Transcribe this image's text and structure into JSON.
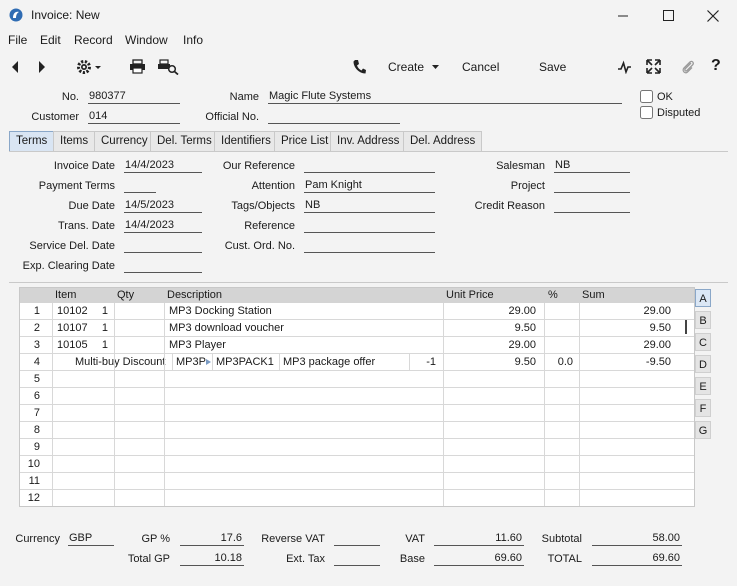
{
  "window": {
    "title": "Invoice: New",
    "minimize_glyph": "—",
    "maximize_glyph": "☐",
    "close_glyph": "✕"
  },
  "menu": [
    "File",
    "Edit",
    "Record",
    "Window",
    "Info"
  ],
  "toolbar": {
    "create_label": "Create",
    "cancel_label": "Cancel",
    "save_label": "Save",
    "help_label": "?"
  },
  "header": {
    "no_label": "No.",
    "no_value": "980377",
    "name_label": "Name",
    "name_value": "Magic Flute Systems",
    "customer_label": "Customer",
    "customer_value": "014",
    "official_label": "Official No.",
    "official_value": "",
    "ok_label": "OK",
    "disputed_label": "Disputed"
  },
  "tabs": [
    "Terms",
    "Items",
    "Currency",
    "Del. Terms",
    "Identifiers",
    "Price List",
    "Inv. Address",
    "Del. Address"
  ],
  "terms": {
    "invoice_date_label": "Invoice Date",
    "invoice_date": "14/4/2023",
    "payment_terms_label": "Payment Terms",
    "payment_terms": "",
    "due_date_label": "Due Date",
    "due_date": "14/5/2023",
    "trans_date_label": "Trans. Date",
    "trans_date": "14/4/2023",
    "service_del_label": "Service Del. Date",
    "service_del": "",
    "exp_clearing_label": "Exp. Clearing Date",
    "exp_clearing": "",
    "our_ref_label": "Our Reference",
    "our_ref": "",
    "attention_label": "Attention",
    "attention": "Pam Knight",
    "tags_label": "Tags/Objects",
    "tags": "NB",
    "reference_label": "Reference",
    "reference": "",
    "cust_ord_label": "Cust. Ord. No.",
    "cust_ord": "",
    "salesman_label": "Salesman",
    "salesman": "NB",
    "project_label": "Project",
    "project": "",
    "credit_reason_label": "Credit Reason",
    "credit_reason": ""
  },
  "grid": {
    "headers": [
      "Item",
      "Qty",
      "Description",
      "Unit Price",
      "%",
      "Sum"
    ],
    "rows": [
      {
        "n": "1",
        "item": "10102",
        "qty": "1",
        "desc": "MP3 Docking Station",
        "price": "29.00",
        "pct": "",
        "sum": "29.00"
      },
      {
        "n": "2",
        "item": "10107",
        "qty": "1",
        "desc": "MP3 download voucher",
        "price": "9.50",
        "pct": "",
        "sum": "9.50"
      },
      {
        "n": "3",
        "item": "10105",
        "qty": "1",
        "desc": "MP3 Player",
        "price": "29.00",
        "pct": "",
        "sum": "29.00"
      },
      {
        "n": "4",
        "discount_label": "Multi-buy Discount",
        "code": "MP3P",
        "pack": "MP3PACK1",
        "desc": "MP3 package offer",
        "qty": "-1",
        "price": "9.50",
        "pct": "0.0",
        "sum": "-9.50"
      },
      {
        "n": "5"
      },
      {
        "n": "6"
      },
      {
        "n": "7"
      },
      {
        "n": "8"
      },
      {
        "n": "9"
      },
      {
        "n": "10"
      },
      {
        "n": "11"
      },
      {
        "n": "12"
      }
    ],
    "side_tabs": [
      "A",
      "B",
      "C",
      "D",
      "E",
      "F",
      "G"
    ]
  },
  "footer": {
    "currency_label": "Currency",
    "currency": "GBP",
    "gp_pct_label": "GP %",
    "gp_pct": "17.6",
    "total_gp_label": "Total GP",
    "total_gp": "10.18",
    "reverse_vat_label": "Reverse VAT",
    "reverse_vat": "",
    "ext_tax_label": "Ext. Tax",
    "ext_tax": "",
    "vat_label": "VAT",
    "vat": "11.60",
    "base_label": "Base",
    "base": "69.60",
    "subtotal_label": "Subtotal",
    "subtotal": "58.00",
    "total_label": "TOTAL",
    "total": "69.60"
  }
}
